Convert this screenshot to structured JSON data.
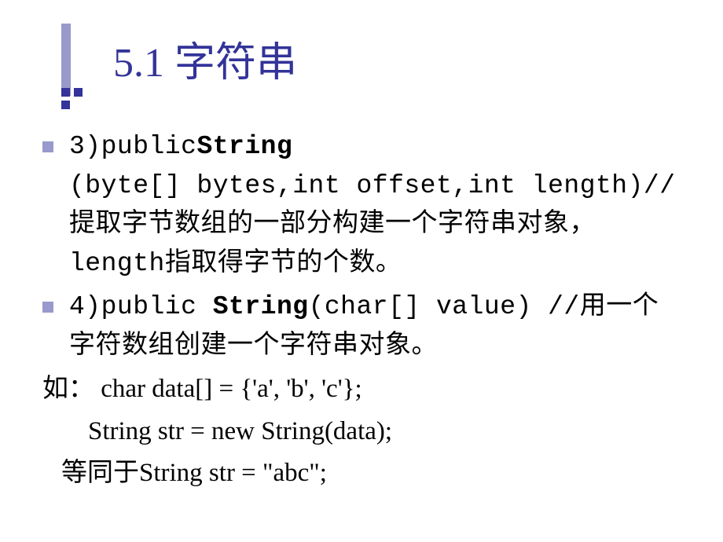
{
  "title": "5.1 字符串",
  "items": [
    {
      "prefix": "3)public",
      "bold": "String",
      "line2": "(byte[]  bytes,int  offset,int  length)//提取字节数组的一部分构建一个字符串对象，length指取得字节的个数。"
    },
    {
      "prefix": "4)public ",
      "bold": "String",
      "tail": "(char[]  value) //用一个字符数组创建一个字符串对象。"
    }
  ],
  "example": {
    "l1_a": "如：",
    "l1_b": "  char data[] = {'a', 'b', 'c'};",
    "l2": "String str = new String(data);",
    "l3_a": "等同于",
    "l3_b": "String str = \"abc\";"
  }
}
